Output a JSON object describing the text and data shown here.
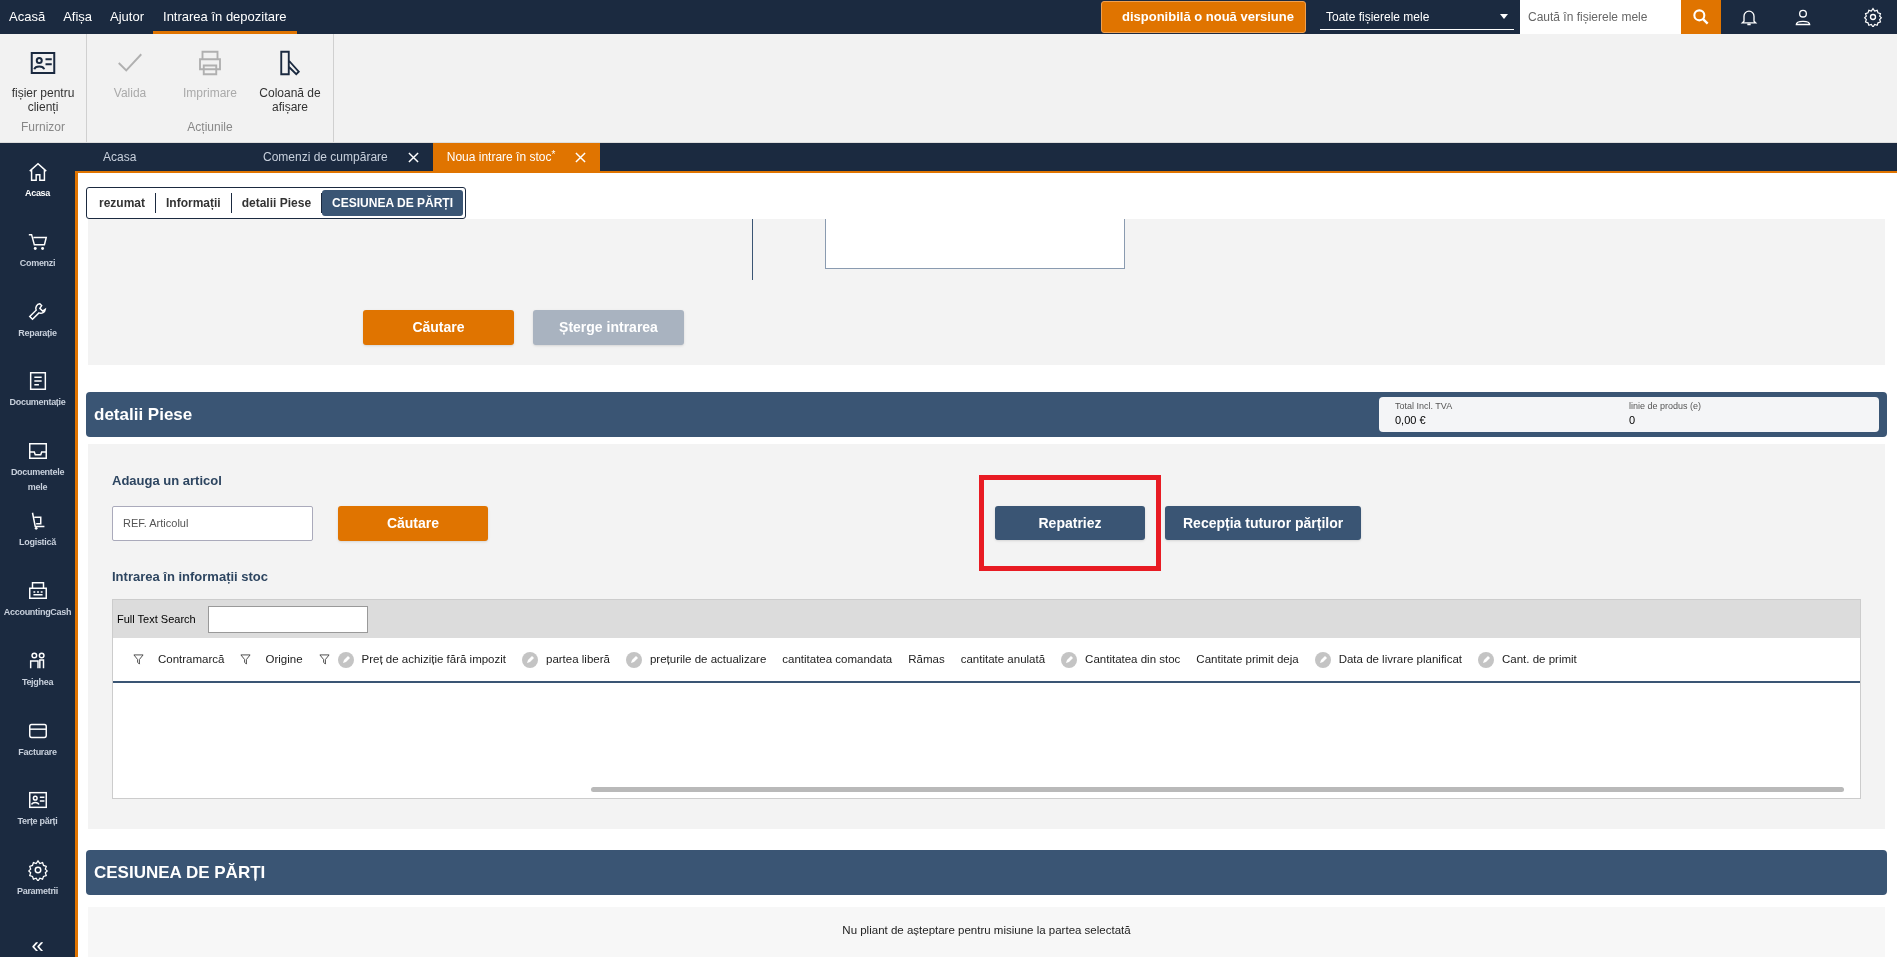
{
  "menu": [
    {
      "label": "Acasă",
      "selected": false
    },
    {
      "label": "Afișa",
      "selected": false
    },
    {
      "label": "Ajutor",
      "selected": false
    },
    {
      "label": "Intrarea în depozitare",
      "selected": true
    }
  ],
  "update_button": "disponibilă o nouă versiune",
  "scope_select": "Toate fișierele mele",
  "search": {
    "placeholder": "Caută în fișierele mele"
  },
  "ribbon": [
    {
      "group": "Furnizor",
      "items": [
        {
          "label": "fișier pentru clienți",
          "disabled": false
        }
      ]
    },
    {
      "group": "Acțiunile",
      "items": [
        {
          "label": "Valida",
          "disabled": true
        },
        {
          "label": "Imprimare",
          "disabled": true
        },
        {
          "label": "Coloană de afișare",
          "disabled": false
        }
      ]
    }
  ],
  "sidebar": [
    {
      "label": "Acasa",
      "selected": true
    },
    {
      "label": "Comenzi",
      "selected": false
    },
    {
      "label": "Reparație",
      "selected": false
    },
    {
      "label": "Documentație",
      "selected": false
    },
    {
      "label": "Documentele mele",
      "selected": false
    },
    {
      "label": "Logistică",
      "selected": false
    },
    {
      "label": "AccountingCash",
      "selected": false
    },
    {
      "label": "Tejghea",
      "selected": false
    },
    {
      "label": "Facturare",
      "selected": false
    },
    {
      "label": "Terțe părți",
      "selected": false
    },
    {
      "label": "Parametrii",
      "selected": false
    }
  ],
  "collapse": "«",
  "doc_tabs": [
    {
      "label": "Acasa",
      "selected": false,
      "closable": false
    },
    {
      "label": "Comenzi de cumpărare",
      "selected": false,
      "closable": true
    },
    {
      "label": "Noua intrare în stoc",
      "selected": true,
      "closable": true,
      "marker": "*"
    }
  ],
  "section_tabs": [
    {
      "label": "rezumat",
      "selected": false
    },
    {
      "label": "Informații",
      "selected": false
    },
    {
      "label": "detalii Piese",
      "selected": false
    },
    {
      "label": "CESIUNEA DE PĂRȚI",
      "selected": true
    }
  ],
  "top_panel": {
    "buttons": [
      {
        "label": "Căutare",
        "disabled": false
      },
      {
        "label": "Șterge intrarea",
        "disabled": true
      }
    ]
  },
  "details": {
    "title": "detalii Piese",
    "stats": [
      {
        "label": "Total Incl. TVA",
        "value": "0,00 €"
      },
      {
        "label": "linie de produs (e)",
        "value": "0"
      }
    ],
    "add_label": "Adauga un articol",
    "ref_field": {
      "placeholder": "REF. Articolul"
    },
    "search_button": "Căutare",
    "actions": [
      {
        "label": "Repatriez",
        "highlighted": true
      },
      {
        "label": "Recepția tuturor părților",
        "highlighted": false
      }
    ],
    "stock_title": "Intrarea în informații stoc",
    "full_text_search": "Full Text Search",
    "columns": [
      {
        "label": "Contramarcă",
        "filterable": true,
        "editable": false
      },
      {
        "label": "Origine",
        "filterable": true,
        "editable": false
      },
      {
        "label": "Preț de achiziție fără impozit",
        "filterable": true,
        "editable": true
      },
      {
        "label": "partea liberă",
        "filterable": false,
        "editable": true
      },
      {
        "label": "prețurile de actualizare",
        "filterable": false,
        "editable": true
      },
      {
        "label": "cantitatea comandata",
        "filterable": false,
        "editable": false
      },
      {
        "label": "Rămas",
        "filterable": false,
        "editable": false
      },
      {
        "label": "cantitate anulată",
        "filterable": false,
        "editable": false
      },
      {
        "label": "Cantitatea din stoc",
        "filterable": false,
        "editable": true
      },
      {
        "label": "Cantitate primit deja",
        "filterable": false,
        "editable": false
      },
      {
        "label": "Data de livrare planificat",
        "filterable": false,
        "editable": true
      },
      {
        "label": "Cant. de primit",
        "filterable": false,
        "editable": true
      }
    ]
  },
  "cession": {
    "title": "CESIUNEA DE PĂRȚI",
    "message": "Nu pliant de așteptare pentru misiune la partea selectată"
  }
}
